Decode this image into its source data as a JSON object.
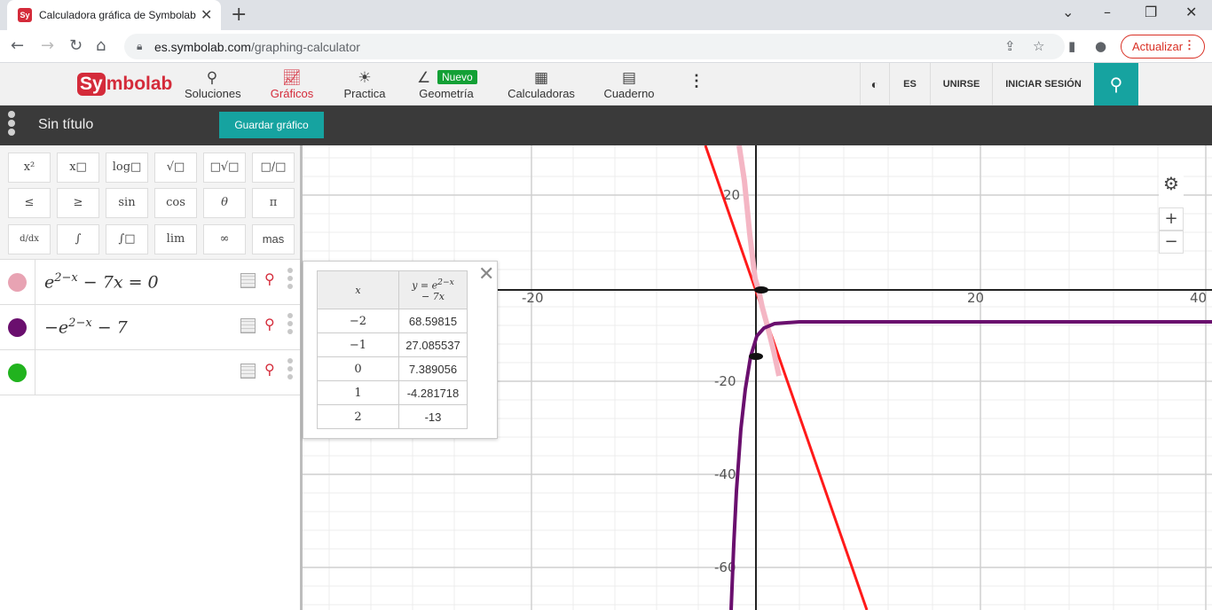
{
  "browser": {
    "tab_favicon": "Sy",
    "tab_title": "Calculadora gráfica de Symbolab",
    "url_domain": "es.symbolab.com",
    "url_path": "/graphing-calculator",
    "update_label": "Actualizar"
  },
  "site": {
    "logo_badge": "Sy",
    "logo_rest": "mbolab",
    "nav": [
      {
        "label": "Soluciones",
        "icon": "search-icon"
      },
      {
        "label": "Gráficos",
        "icon": "chart-icon"
      },
      {
        "label": "Practica",
        "icon": "lightbulb-icon"
      },
      {
        "label": "Geometría",
        "icon": "angle-icon"
      },
      {
        "label": "Calculadoras",
        "icon": "calculator-icon"
      },
      {
        "label": "Cuaderno",
        "icon": "notebook-icon"
      }
    ],
    "nuevo_badge": "Nuevo",
    "lang": "ES",
    "join": "UNIRSE",
    "login": "INICIAR SESIÓN",
    "brand_color": "#d42b3a",
    "accent_color": "#16a3a0"
  },
  "graphbar": {
    "title": "Sin título",
    "save_label": "Guardar gráfico"
  },
  "keyboard": {
    "row1": [
      "x²",
      "x□",
      "log□",
      "√□",
      "□√□",
      "□/□"
    ],
    "row2": [
      "≤",
      "≥",
      "sin",
      "cos",
      "θ",
      "π"
    ],
    "row3": [
      "d/dx",
      "∫",
      "∫□",
      "lim",
      "∞",
      "mas"
    ]
  },
  "expressions": [
    {
      "color": "#e8a3b3",
      "base": "e",
      "exponent": "2−x",
      "rest": "− 7x = 0"
    },
    {
      "color": "#6a0f6e",
      "base": "−e",
      "exponent": "2−x",
      "rest": "− 7"
    },
    {
      "color": "#21b31e",
      "base": "",
      "exponent": "",
      "rest": ""
    }
  ],
  "value_table": {
    "col_x": "x",
    "col_y_top": "y = e",
    "col_y_exp": "2−x",
    "col_y_bottom": "− 7x",
    "rows": [
      {
        "x": "−2",
        "y": "68.59815"
      },
      {
        "x": "−1",
        "y": "27.085537"
      },
      {
        "x": "0",
        "y": "7.389056"
      },
      {
        "x": "1",
        "y": "-4.281718"
      },
      {
        "x": "2",
        "y": "-13"
      }
    ]
  },
  "graph": {
    "x_ticks": [
      "-20",
      "20",
      "40"
    ],
    "y_ticks": [
      "20",
      "-20",
      "-40",
      "-60"
    ]
  }
}
